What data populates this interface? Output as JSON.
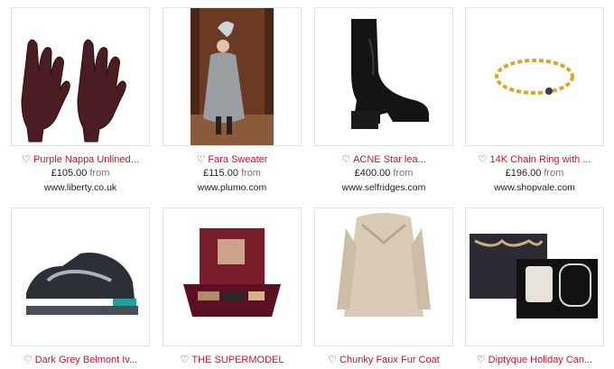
{
  "products": [
    {
      "title": "Purple Nappa Unlined...",
      "price": "£105.00",
      "from": "from",
      "store": "www.liberty.co.uk",
      "image": "gloves"
    },
    {
      "title": "Fara Sweater",
      "price": "£115.00",
      "from": "from",
      "store": "www.plumo.com",
      "image": "sweater-model"
    },
    {
      "title": "ACNE Star lea...",
      "price": "£400.00",
      "from": "from",
      "store": "www.selfridges.com",
      "image": "ankle-boot"
    },
    {
      "title": "14K Chain Ring with ...",
      "price": "£196.00",
      "from": "from",
      "store": "www.shopvale.com",
      "image": "chain-ring"
    },
    {
      "title": "Dark Grey Belmont Iv...",
      "image": "sneaker"
    },
    {
      "title": "THE SUPERMODEL",
      "image": "makeup-palette"
    },
    {
      "title": "Chunky Faux Fur Coat",
      "image": "fur-coat"
    },
    {
      "title": "Diptyque Holiday Can...",
      "image": "candle-set"
    }
  ],
  "colors": {
    "accent": "#c0182b",
    "border": "#e3e3e3"
  }
}
